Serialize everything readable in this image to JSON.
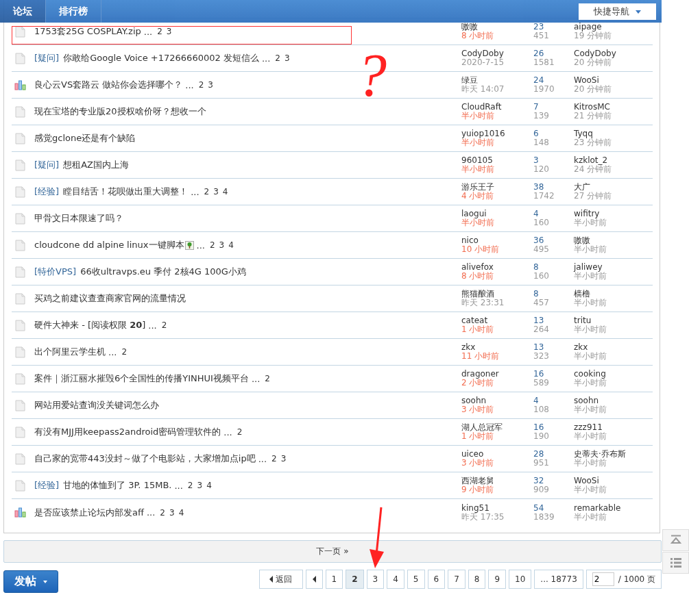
{
  "nav": {
    "tabs": [
      {
        "label": "论坛",
        "selected": true
      },
      {
        "label": "排行榜",
        "selected": false
      }
    ],
    "quick_nav": "快捷导航"
  },
  "threads": [
    {
      "kind": "file",
      "title": "1753套25G COSPLAY.zip",
      "pages_lead": "...",
      "pages": [
        "2",
        "3"
      ],
      "author": "嗷嗷",
      "time": "8 小时前",
      "recent": true,
      "replies": "23",
      "views": "451",
      "last_poster": "aipage",
      "last_time": "19 分钟前"
    },
    {
      "kind": "file",
      "tag": "[疑问]",
      "title": "你敢给Google Voice +17266660002 发短信么",
      "pages_lead": "...",
      "pages": [
        "2",
        "3"
      ],
      "author": "CodyDoby",
      "time": "2020-7-15",
      "recent": false,
      "replies": "26",
      "views": "1581",
      "last_poster": "CodyDoby",
      "last_time": "20 分钟前"
    },
    {
      "kind": "poll",
      "title": "良心云VS套路云 做站你会选择哪个？",
      "pages_lead": "...",
      "pages": [
        "2",
        "3"
      ],
      "author": "绿豆",
      "time": "昨天 14:07",
      "recent": false,
      "replies": "24",
      "views": "1970",
      "last_poster": "WooSi",
      "last_time": "20 分钟前"
    },
    {
      "kind": "file",
      "title": "现在宝塔的专业版20授权啥价呀？想收一个",
      "author": "CloudRaft",
      "time": "半小时前",
      "recent": true,
      "replies": "7",
      "views": "139",
      "last_poster": "KitrosMC",
      "last_time": "21 分钟前"
    },
    {
      "kind": "file",
      "title": "感觉gclone还是有个缺陷",
      "author": "yuiop1016",
      "time": "半小时前",
      "recent": true,
      "replies": "6",
      "views": "148",
      "last_poster": "Tyqq",
      "last_time": "23 分钟前"
    },
    {
      "kind": "file",
      "tag": "[疑问]",
      "title": "想租AZ国内上海",
      "author": "960105",
      "time": "半小时前",
      "recent": true,
      "replies": "3",
      "views": "120",
      "last_poster": "kzklot_2",
      "last_time": "24 分钟前"
    },
    {
      "kind": "file",
      "tag": "[经验]",
      "title": "瞠目结舌！花呗做出重大调整！",
      "pages_lead": "...",
      "pages": [
        "2",
        "3",
        "4"
      ],
      "author": "游乐王子",
      "time": "4 小时前",
      "recent": true,
      "replies": "38",
      "views": "1742",
      "last_poster": "大广",
      "last_time": "27 分钟前"
    },
    {
      "kind": "file",
      "title": "甲骨文日本限速了吗？",
      "author": "laogui",
      "time": "半小时前",
      "recent": true,
      "replies": "4",
      "views": "160",
      "last_poster": "wifitry",
      "last_time": "半小时前"
    },
    {
      "kind": "file",
      "title": "cloudcone dd alpine linux一键脚本",
      "has_image": true,
      "pages_lead": "...",
      "pages": [
        "2",
        "3",
        "4"
      ],
      "author": "nico",
      "time": "10 小时前",
      "recent": true,
      "replies": "36",
      "views": "495",
      "last_poster": "嗷嗷",
      "last_time": "半小时前"
    },
    {
      "kind": "file",
      "tag": "[特价VPS]",
      "title": "66收ultravps.eu 季付 2核4G 100G小鸡",
      "author": "alivefox",
      "time": "8 小时前",
      "recent": true,
      "replies": "8",
      "views": "160",
      "last_poster": "jaliwey",
      "last_time": "半小时前"
    },
    {
      "kind": "file",
      "title": "买鸡之前建议查查商家官网的流量情况",
      "author": "熊猫酿酒",
      "time": "昨天 23:31",
      "recent": false,
      "replies": "8",
      "views": "457",
      "last_poster": "樯橹",
      "last_time": "半小时前"
    },
    {
      "kind": "file",
      "title": "硬件大神来 - [阅读权限 **20**]",
      "pages_lead": "...",
      "pages": [
        "2"
      ],
      "author": "cateat",
      "time": "1 小时前",
      "recent": true,
      "replies": "13",
      "views": "264",
      "last_poster": "tritu",
      "last_time": "半小时前"
    },
    {
      "kind": "file",
      "title": "出个阿里云学生机",
      "pages_lead": "...",
      "pages": [
        "2"
      ],
      "author": "zkx",
      "time": "11 小时前",
      "recent": true,
      "replies": "13",
      "views": "323",
      "last_poster": "zkx",
      "last_time": "半小时前"
    },
    {
      "kind": "file",
      "title": "案件｜浙江丽水摧毁6个全国性的传播YINHUI视频平台",
      "pages_lead": "...",
      "pages": [
        "2"
      ],
      "author": "dragoner",
      "time": "2 小时前",
      "recent": true,
      "replies": "16",
      "views": "589",
      "last_poster": "cooking",
      "last_time": "半小时前"
    },
    {
      "kind": "file",
      "title": "网站用爱站查询没关键词怎么办",
      "author": "soohn",
      "time": "3 小时前",
      "recent": true,
      "replies": "4",
      "views": "108",
      "last_poster": "soohn",
      "last_time": "半小时前"
    },
    {
      "kind": "file",
      "title": "有没有MJJ用keepass2android密码管理软件的",
      "pages_lead": "...",
      "pages": [
        "2"
      ],
      "author": "湖人总冠军",
      "time": "1 小时前",
      "recent": true,
      "replies": "16",
      "views": "190",
      "last_poster": "zzz911",
      "last_time": "半小时前"
    },
    {
      "kind": "file",
      "title": "自己家的宽带443没封～做了个电影站，大家增加点ip吧",
      "pages_lead": "...",
      "pages": [
        "2",
        "3"
      ],
      "author": "uiceo",
      "time": "3 小时前",
      "recent": true,
      "replies": "28",
      "views": "951",
      "last_poster": "史蒂夫·乔布斯",
      "last_time": "半小时前"
    },
    {
      "kind": "file",
      "tag": "[经验]",
      "title": "甘地的体恤到了 3P. 15MB.",
      "pages_lead": "...",
      "pages": [
        "2",
        "3",
        "4"
      ],
      "author": "西湖老舅",
      "time": "9 小时前",
      "recent": true,
      "replies": "32",
      "views": "909",
      "last_poster": "WooSi",
      "last_time": "半小时前"
    },
    {
      "kind": "poll",
      "title": "是否应该禁止论坛内部发aff",
      "pages_lead": "...",
      "pages": [
        "2",
        "3",
        "4"
      ],
      "author": "king51",
      "time": "昨天 17:35",
      "recent": false,
      "replies": "54",
      "views": "1839",
      "last_poster": "remarkable",
      "last_time": "半小时前"
    }
  ],
  "next_page": "下一页 »",
  "post_button": "发帖",
  "pagination": {
    "back": "返回",
    "pages": [
      {
        "label": "1",
        "selected": false
      },
      {
        "label": "2",
        "selected": true
      },
      {
        "label": "3",
        "selected": false
      },
      {
        "label": "4",
        "selected": false
      },
      {
        "label": "5",
        "selected": false
      },
      {
        "label": "6",
        "selected": false
      },
      {
        "label": "7",
        "selected": false
      },
      {
        "label": "8",
        "selected": false
      },
      {
        "label": "9",
        "selected": false
      },
      {
        "label": "10",
        "selected": false
      },
      {
        "label": "... 18773",
        "selected": false
      }
    ],
    "page_input": "2",
    "total": "/ 1000 页"
  },
  "annotations": {
    "question_mark": "?"
  }
}
